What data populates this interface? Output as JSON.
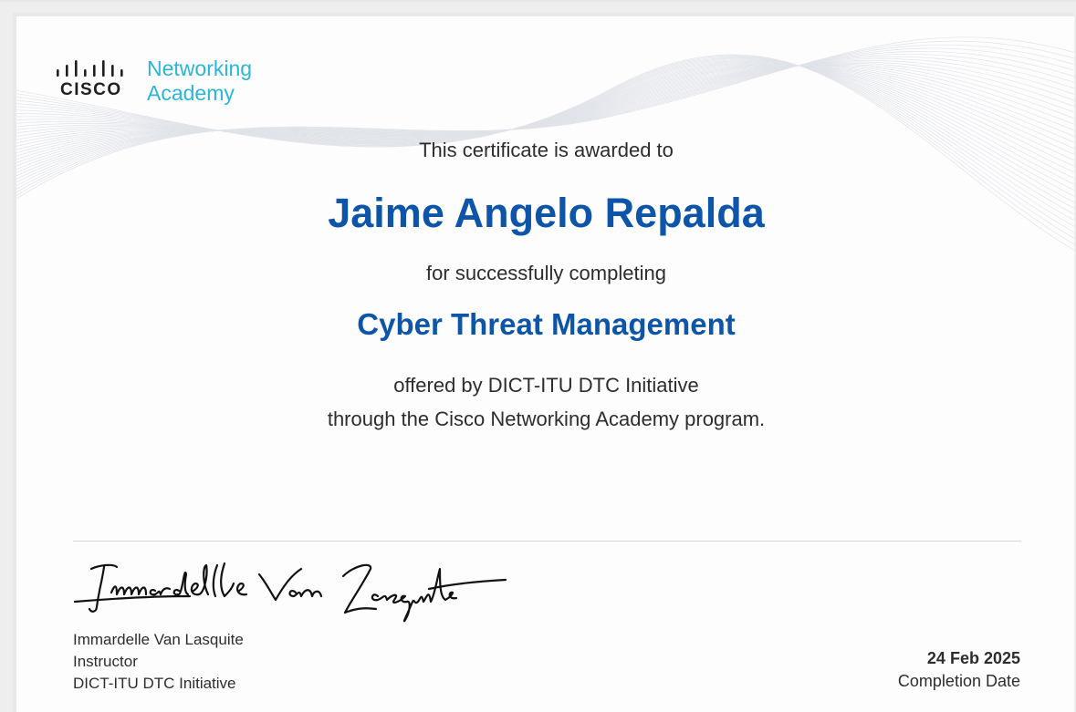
{
  "logo": {
    "brand": "CISCO",
    "line1": "Networking",
    "line2": "Academy"
  },
  "certificate": {
    "awarded_text": "This certificate is awarded to",
    "recipient_name": "Jaime Angelo Repalda",
    "completing_text": "for successfully completing",
    "course_name": "Cyber Threat Management",
    "offered_line1": "offered by DICT-ITU DTC Initiative",
    "offered_line2": "through the Cisco Networking Academy program."
  },
  "instructor": {
    "signature": "Immardelle Van Lasquite",
    "name": "Immardelle Van Lasquite",
    "role": "Instructor",
    "organization": "DICT-ITU DTC Initiative"
  },
  "completion": {
    "date": "24 Feb 2025",
    "label": "Completion Date"
  },
  "colors": {
    "accent_blue": "#0d55a8",
    "logo_cyan": "#2bb5d8",
    "text": "#2d2d2d"
  }
}
